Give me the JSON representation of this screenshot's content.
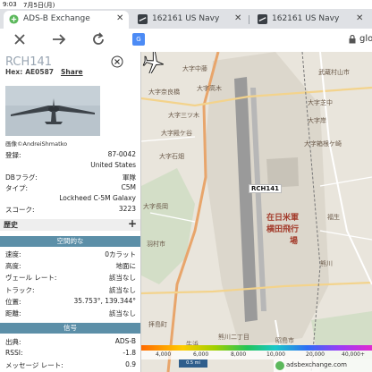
{
  "status": {
    "time": "9:03",
    "date": "7月5日(月)"
  },
  "tabs": [
    {
      "label": "ADS-B Exchange",
      "active": true
    },
    {
      "label": "162161 US Navy",
      "active": false
    },
    {
      "label": "162161 US Navy",
      "active": false
    }
  ],
  "toolbar": {
    "translate_label": "G",
    "url": "glo"
  },
  "aircraft": {
    "callsign": "RCH141",
    "hex_label": "Hex:",
    "hex": "AE0587",
    "share": "Share",
    "photo_credit": "画像©AndreiShmatko"
  },
  "details": [
    {
      "label": "登録:",
      "value": "87-0042"
    },
    {
      "label": "",
      "value": "United States"
    },
    {
      "label": "DBフラグ:",
      "value": "軍隊"
    },
    {
      "label": "タイプ:",
      "value": "C5M"
    },
    {
      "label": "",
      "value": "Lockheed C-5M Galaxy"
    },
    {
      "label": "スコーク:",
      "value": "3223"
    }
  ],
  "history_label": "歴史",
  "history_plus": "+",
  "spatial_header": "空間的な",
  "spatial": [
    {
      "label": "速度:",
      "value": "0カラット"
    },
    {
      "label": "高度:",
      "value": "地面に"
    },
    {
      "label": "ヴェール レート:",
      "value": "該当なし"
    },
    {
      "label": "トラック:",
      "value": "該当なし"
    },
    {
      "label": "位置:",
      "value": "35.753°, 139.344°"
    },
    {
      "label": "距離:",
      "value": "該当なし"
    }
  ],
  "signal_header": "信号",
  "signal": [
    {
      "label": "出典:",
      "value": "ADS-B"
    },
    {
      "label": "RSSI:",
      "value": "-1.8"
    },
    {
      "label": "メッセージ レート:",
      "value": "0.9"
    }
  ],
  "map": {
    "callsign_tag": "RCH141",
    "base_label_1": "在日米軍",
    "base_label_2": "横田飛行",
    "base_label_3": "場",
    "labels": {
      "l1": "大字中藤",
      "l2": "大字高木",
      "l3": "大字奈良橋",
      "l4": "大字芝中",
      "l5": "大字岸",
      "l6": "大字三ツ木",
      "l7": "大字殿ケ谷",
      "l8": "大字箱根ケ崎",
      "l9": "大字石畑",
      "l10": "大字長岡",
      "l11": "福生",
      "l12": "羽村市",
      "l13": "熊川",
      "l14": "武蔵村山市",
      "l15": "昭島市",
      "l16": "拝島町",
      "l17": "牛浜",
      "l18": "熊川二丁目"
    },
    "alt_ticks": [
      "4,000",
      "6,000",
      "8,000",
      "10,000",
      "20,000",
      "40,000+"
    ],
    "scale": "0.5 mi",
    "brand": "adsbexchange.com"
  },
  "colors": {
    "accent": "#5c8fa8",
    "callsign": "#9aa6b3",
    "map_bg": "#e9e5dc",
    "runway": "#9a9a9a",
    "base_area": "#dcd7cc"
  }
}
